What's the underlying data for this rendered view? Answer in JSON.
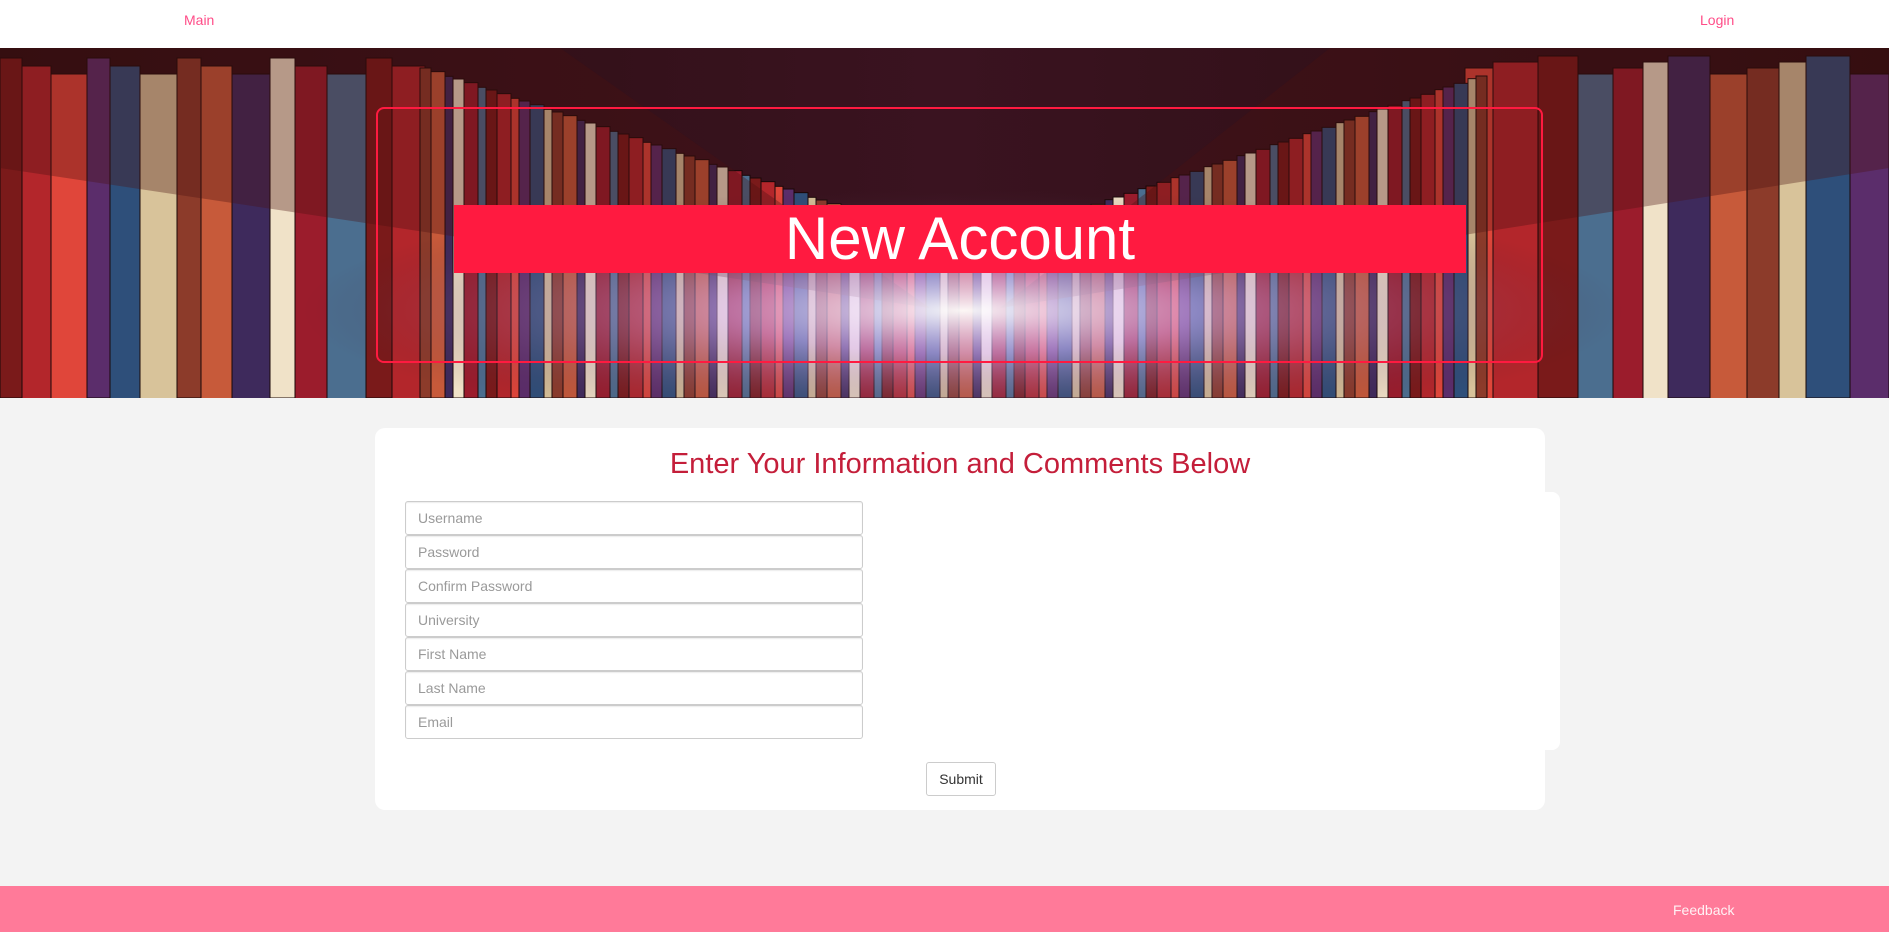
{
  "nav": {
    "main_label": "Main",
    "login_label": "Login"
  },
  "hero": {
    "title": "New Account"
  },
  "form": {
    "heading": "Enter Your Information and Comments Below",
    "fields": [
      {
        "placeholder": "Username",
        "value": ""
      },
      {
        "placeholder": "Password",
        "value": ""
      },
      {
        "placeholder": "Confirm Password",
        "value": ""
      },
      {
        "placeholder": "University",
        "value": ""
      },
      {
        "placeholder": "First Name",
        "value": ""
      },
      {
        "placeholder": "Last Name",
        "value": ""
      },
      {
        "placeholder": "Email",
        "value": ""
      }
    ],
    "submit_label": "Submit"
  },
  "footer": {
    "feedback_label": "Feedback"
  },
  "colors": {
    "accent": "#ff1a40",
    "link": "#ff4d88",
    "heading": "#c41e3a",
    "footer": "#ff7a99",
    "background": "#f3f3f3"
  }
}
